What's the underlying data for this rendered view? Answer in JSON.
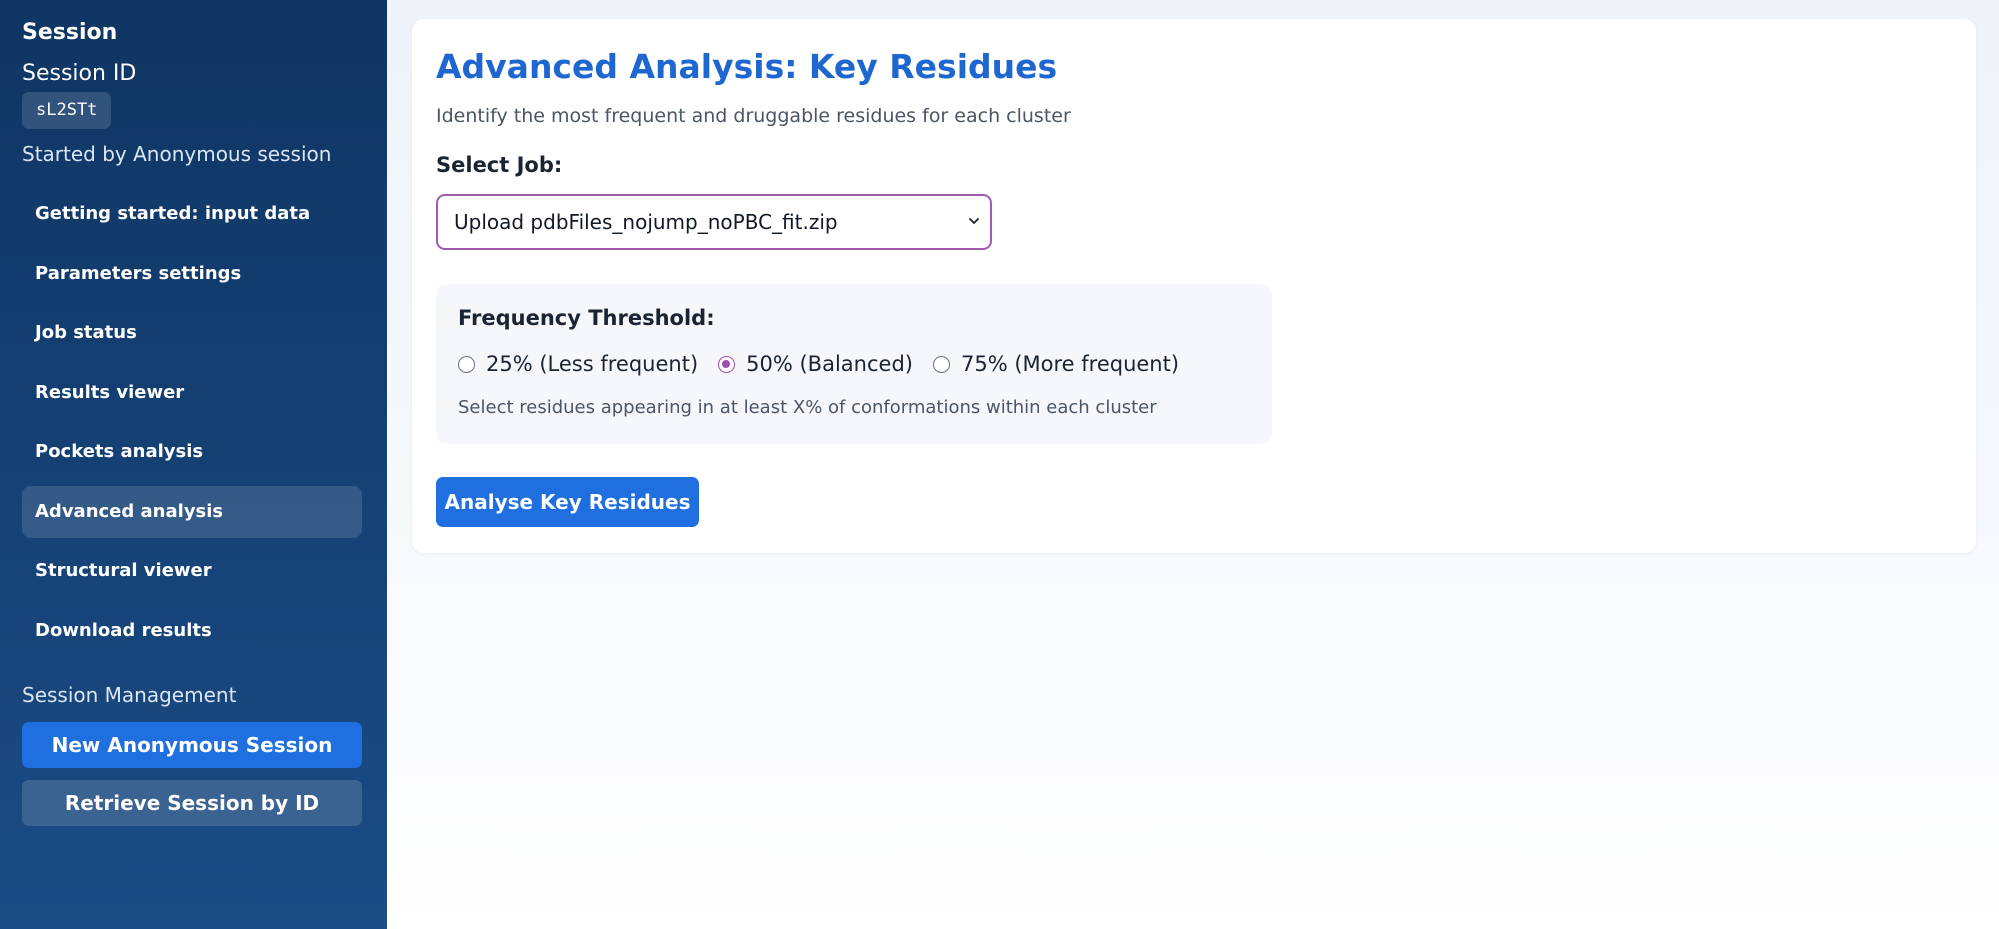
{
  "sidebar": {
    "title": "Session",
    "session_id_label": "Session ID",
    "session_id": "sL2STt",
    "started_by": "Started by Anonymous session",
    "nav": [
      {
        "label": "Getting started: input data",
        "active": false
      },
      {
        "label": "Parameters settings",
        "active": false
      },
      {
        "label": "Job status",
        "active": false
      },
      {
        "label": "Results viewer",
        "active": false
      },
      {
        "label": "Pockets analysis",
        "active": false
      },
      {
        "label": "Advanced analysis",
        "active": true
      },
      {
        "label": "Structural viewer",
        "active": false
      },
      {
        "label": "Download results",
        "active": false
      }
    ],
    "management_label": "Session Management",
    "new_session_label": "New Anonymous Session",
    "retrieve_session_label": "Retrieve Session by ID"
  },
  "main": {
    "title": "Advanced Analysis: Key Residues",
    "subtitle": "Identify the most frequent and druggable residues for each cluster",
    "select_job_label": "Select Job:",
    "selected_job": "Upload pdbFiles_nojump_noPBC_fit.zip",
    "frequency": {
      "title": "Frequency Threshold:",
      "options": [
        {
          "label": "25% (Less frequent)",
          "checked": false
        },
        {
          "label": "50% (Balanced)",
          "checked": true
        },
        {
          "label": "75% (More frequent)",
          "checked": false
        }
      ],
      "help": "Select residues appearing in at least X% of conformations within each cluster"
    },
    "analyse_button_label": "Analyse Key Residues"
  },
  "colors": {
    "sidebar_top": "#0f3563",
    "sidebar_bottom": "#1b4c85",
    "accent_blue": "#1f6fe0",
    "title_blue": "#1e66d0",
    "select_border": "#a05ab0",
    "radio_checked": "#9b4fae"
  },
  "icons": {
    "select_chevron": "chevron-down-icon"
  }
}
